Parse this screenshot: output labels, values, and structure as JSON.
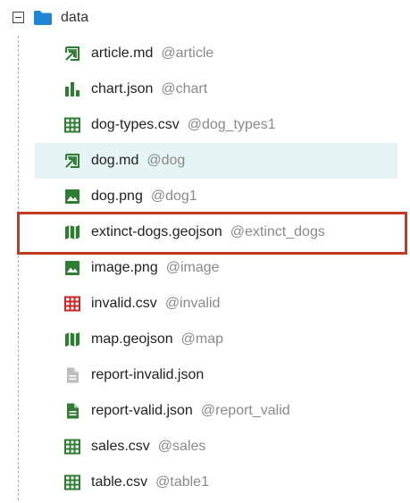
{
  "root": {
    "label": "data",
    "icon": "folder-icon",
    "expanded": true,
    "folder_color": "#1f86d6"
  },
  "files": [
    {
      "name": "article.md",
      "alias": "@article",
      "icon": "markdown-icon",
      "color": "#2e7d32",
      "selected": false
    },
    {
      "name": "chart.json",
      "alias": "@chart",
      "icon": "bar-chart-icon",
      "color": "#2e7d32",
      "selected": false
    },
    {
      "name": "dog-types.csv",
      "alias": "@dog_types1",
      "icon": "table-icon",
      "color": "#2e7d32",
      "selected": false
    },
    {
      "name": "dog.md",
      "alias": "@dog",
      "icon": "markdown-icon",
      "color": "#2e7d32",
      "selected": true
    },
    {
      "name": "dog.png",
      "alias": "@dog1",
      "icon": "image-icon",
      "color": "#2e7d32",
      "selected": false
    },
    {
      "name": "extinct-dogs.geojson",
      "alias": "@extinct_dogs",
      "icon": "map-icon",
      "color": "#2e7d32",
      "selected": false,
      "highlighted": true
    },
    {
      "name": "image.png",
      "alias": "@image",
      "icon": "image-icon",
      "color": "#2e7d32",
      "selected": false
    },
    {
      "name": "invalid.csv",
      "alias": "@invalid",
      "icon": "table-icon",
      "color": "#c62828",
      "selected": false
    },
    {
      "name": "map.geojson",
      "alias": "@map",
      "icon": "map-icon",
      "color": "#2e7d32",
      "selected": false
    },
    {
      "name": "report-invalid.json",
      "alias": "",
      "icon": "document-icon",
      "color": "#bdbdbd",
      "selected": false
    },
    {
      "name": "report-valid.json",
      "alias": "@report_valid",
      "icon": "document-icon",
      "color": "#2e7d32",
      "selected": false
    },
    {
      "name": "sales.csv",
      "alias": "@sales",
      "icon": "table-icon",
      "color": "#2e7d32",
      "selected": false
    },
    {
      "name": "table.csv",
      "alias": "@table1",
      "icon": "table-icon",
      "color": "#2e7d32",
      "selected": false
    }
  ],
  "colors": {
    "selection_bg": "#e6f4f5",
    "highlight_border": "#c23a22",
    "alias_text": "#8a8a8a"
  }
}
